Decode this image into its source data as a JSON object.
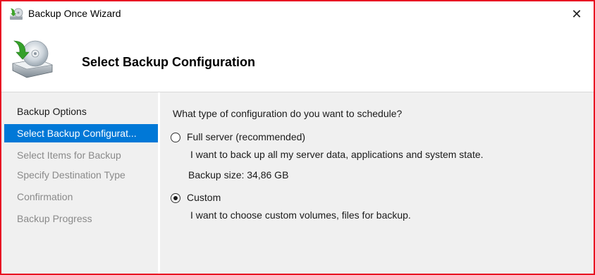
{
  "window": {
    "title": "Backup Once Wizard",
    "close_glyph": "✕",
    "frame_color": "#e81123"
  },
  "header": {
    "title": "Select Backup Configuration",
    "icon": "backup-drive-icon"
  },
  "nav": {
    "items": [
      {
        "label": "Backup Options",
        "state": "done"
      },
      {
        "label": "Select Backup Configurat...",
        "state": "active"
      },
      {
        "label": "Select Items for Backup",
        "state": "pending"
      },
      {
        "label": "Specify Destination Type",
        "state": "pending"
      },
      {
        "label": "Confirmation",
        "state": "pending"
      },
      {
        "label": "Backup Progress",
        "state": "pending"
      }
    ],
    "active_color": "#0078d7"
  },
  "content": {
    "question": "What type of configuration do you want to schedule?",
    "options": [
      {
        "label": "Full server (recommended)",
        "description": "I want to back up all my server data, applications and system state.",
        "extra": "Backup size: 34,86 GB",
        "selected": false
      },
      {
        "label": "Custom",
        "description": "I want to choose custom volumes, files for backup.",
        "selected": true
      }
    ]
  }
}
